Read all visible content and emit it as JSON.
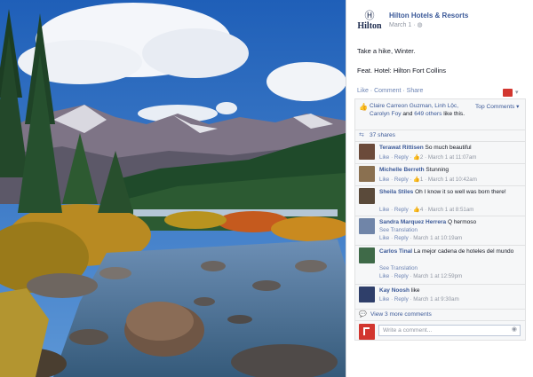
{
  "page": {
    "name": "Hilton Hotels & Resorts",
    "date": "March 1",
    "logo_text": "Hilton",
    "logo_glyph": "Ⓗ"
  },
  "post": {
    "line1": "Take a hike, Winter.",
    "line2": "Feat. Hotel: Hilton Fort Collins"
  },
  "actions": {
    "like": "Like",
    "comment": "Comment",
    "share": "Share",
    "sep": " · "
  },
  "likes": {
    "names": "Claire Carreon Guzman, Linh Lộc, Carolyn Foy",
    "and": " and ",
    "others": "649 others",
    "suffix": " like this.",
    "top_comments": "Top Comments ▾"
  },
  "shares": {
    "text": "37 shares"
  },
  "comments": [
    {
      "name": "Terawat Rittisen",
      "text": "So much beautiful",
      "like": "Like",
      "reply": "Reply",
      "likes": "2",
      "time": "March 1 at 11:07am",
      "translation": ""
    },
    {
      "name": "Michelle Berreth",
      "text": "Stunning",
      "like": "Like",
      "reply": "Reply",
      "likes": "1",
      "time": "March 1 at 10:42am",
      "translation": ""
    },
    {
      "name": "Sheila Stiles",
      "text": "Oh I know it so well was born there!",
      "like": "Like",
      "reply": "Reply",
      "likes": "4",
      "time": "March 1 at 8:51am",
      "translation": ""
    },
    {
      "name": "Sandra Marquez Herrera",
      "text": "Q hermoso",
      "like": "Like",
      "reply": "Reply",
      "likes": "",
      "time": "March 1 at 10:19am",
      "translation": "See Translation"
    },
    {
      "name": "Carlos Tinal",
      "text": "La mejor cadena de hoteles del mundo",
      "like": "Like",
      "reply": "Reply",
      "likes": "",
      "time": "March 1 at 12:59pm",
      "translation": "See Translation"
    },
    {
      "name": "Kay Noosh",
      "text": "like",
      "like": "Like",
      "reply": "Reply",
      "likes": "",
      "time": "March 1 at 9:30am",
      "translation": ""
    }
  ],
  "more_comments": "View 3 more comments",
  "write": {
    "placeholder": "Write a comment..."
  },
  "colors": {
    "link": "#3b5998",
    "accent_red": "#d2362f",
    "panel_bg": "#f6f7f8"
  },
  "icons": [
    "hilton-logo-icon",
    "globe-icon",
    "like-thumb-icon",
    "share-icon",
    "comment-bubble-icon",
    "camera-icon"
  ]
}
